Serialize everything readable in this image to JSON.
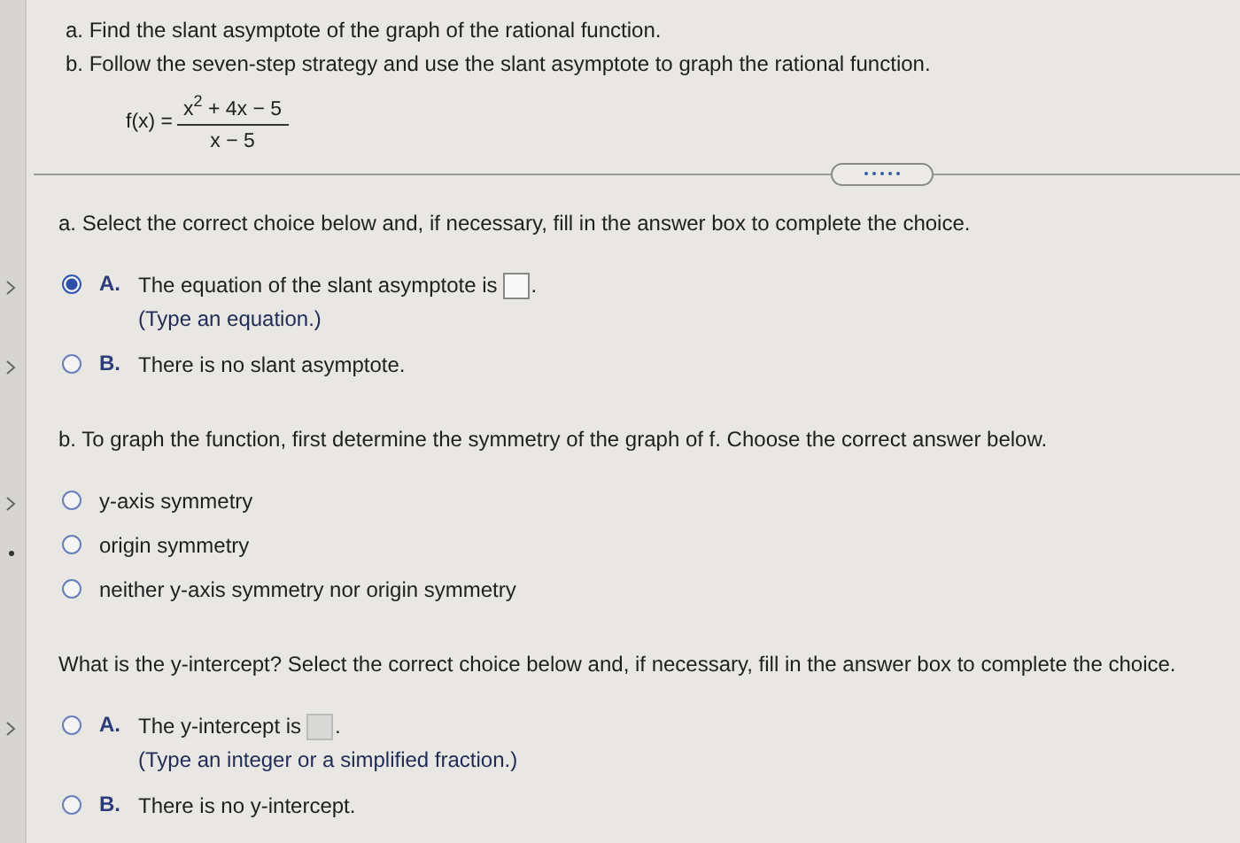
{
  "instructions": [
    "a. Find the slant asymptote of the graph of the rational function.",
    "b. Follow the seven-step strategy and use the slant asymptote to graph the rational function."
  ],
  "function": {
    "lhs": "f(x) =",
    "numerator": "x$^{2}$ + 4x − 5",
    "denominator": "x − 5"
  },
  "questions": [
    {
      "prompt": "a. Select the correct choice below and, if necessary, fill in the answer box to complete the choice.",
      "choices": [
        {
          "letter": "A.",
          "text": "The equation of the slant asymptote is",
          "answer_box": true,
          "suffix": ".",
          "note": "(Type an equation.)",
          "selected": true,
          "gutter_chevron": true,
          "gutter_dot": false
        },
        {
          "letter": "B.",
          "text": "There is no slant asymptote.",
          "selected": false,
          "gutter_chevron": true,
          "gutter_dot": false
        }
      ]
    },
    {
      "prompt": "b. To graph the function, first determine the symmetry of the graph of f. Choose the correct answer below.",
      "choices": [
        {
          "text": "y-axis symmetry",
          "selected": false,
          "gutter_chevron": true,
          "gutter_dot": false
        },
        {
          "text": "origin symmetry",
          "selected": false,
          "gutter_chevron": false,
          "gutter_dot": true
        },
        {
          "text": "neither y-axis symmetry nor origin symmetry",
          "selected": false,
          "gutter_chevron": false,
          "gutter_dot": false
        }
      ]
    },
    {
      "prompt": "What is the y-intercept? Select the correct choice below and, if necessary, fill in the answer box to complete the choice.",
      "choices": [
        {
          "letter": "A.",
          "text": "The y-intercept is",
          "answer_box": true,
          "suffix": ".",
          "note": "(Type an integer or a simplified fraction.)",
          "selected": false,
          "gutter_chevron": true,
          "gutter_dot": false
        },
        {
          "letter": "B.",
          "text": "There is no y-intercept.",
          "selected": false,
          "gutter_chevron": false,
          "gutter_dot": false
        }
      ]
    }
  ]
}
